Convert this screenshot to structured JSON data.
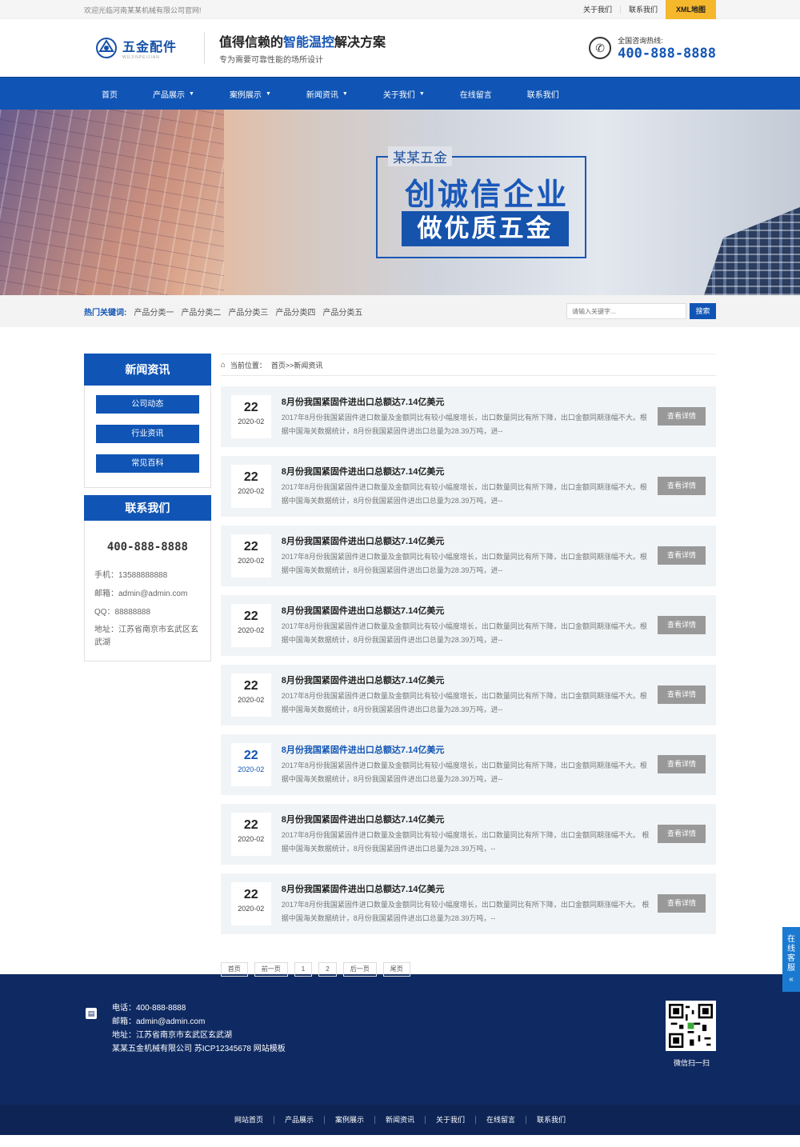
{
  "topbar": {
    "welcome": "欢迎光临河南某某机械有限公司官网!",
    "links": [
      "关于我们",
      "联系我们"
    ],
    "xml": "XML地图"
  },
  "header": {
    "logo_name": "五金配件",
    "logo_sub": "WUJINPEIJIAN",
    "slogan_pre": "值得信赖的",
    "slogan_hl": "智能温控",
    "slogan_post": "解决方案",
    "slogan_sub": "专为需要可靠性能的场所设计",
    "hotline_label": "全国咨询热线:",
    "hotline": "400-888-8888"
  },
  "nav": [
    {
      "label": "首页",
      "dropdown": false
    },
    {
      "label": "产品展示",
      "dropdown": true
    },
    {
      "label": "案例展示",
      "dropdown": true
    },
    {
      "label": "新闻资讯",
      "dropdown": true
    },
    {
      "label": "关于我们",
      "dropdown": true
    },
    {
      "label": "在线留言",
      "dropdown": false
    },
    {
      "label": "联系我们",
      "dropdown": false
    }
  ],
  "banner": {
    "line1": "某某五金",
    "line2": "创诚信企业",
    "line3": "做优质五金"
  },
  "hot": {
    "label": "热门关键词:",
    "keywords": [
      "产品分类一",
      "产品分类二",
      "产品分类三",
      "产品分类四",
      "产品分类五"
    ],
    "placeholder": "请输入关键字...",
    "search": "搜索"
  },
  "side": {
    "news_title": "新闻资讯",
    "links": [
      "公司动态",
      "行业资讯",
      "常见百科"
    ],
    "contact_title": "联系我们",
    "phone": "400-888-8888",
    "mobile": "手机：13588888888",
    "email": "邮箱：admin@admin.com",
    "qq": "QQ：88888888",
    "address": "地址：江苏省南京市玄武区玄武湖"
  },
  "crumb": {
    "label": "当前位置：",
    "path": "首页>>新闻资讯"
  },
  "news": [
    {
      "day": "22",
      "ym": "2020-02",
      "title": "8月份我国紧固件进出口总额达7.14亿美元",
      "desc": "2017年8月份我国紧固件进口数量及金额同比有较小幅度增长，出口数量同比有所下降，出口金额同期涨幅不大。根据中国海关数据统计，8月份我国紧固件进出口总量为28.39万吨，进--",
      "btn": "查看详情"
    },
    {
      "day": "22",
      "ym": "2020-02",
      "title": "8月份我国紧固件进出口总额达7.14亿美元",
      "desc": "2017年8月份我国紧固件进口数量及金额同比有较小幅度增长，出口数量同比有所下降，出口金额同期涨幅不大。根据中国海关数据统计，8月份我国紧固件进出口总量为28.39万吨，进--",
      "btn": "查看详情"
    },
    {
      "day": "22",
      "ym": "2020-02",
      "title": "8月份我国紧固件进出口总额达7.14亿美元",
      "desc": "2017年8月份我国紧固件进口数量及金额同比有较小幅度增长，出口数量同比有所下降，出口金额同期涨幅不大。根据中国海关数据统计，8月份我国紧固件进出口总量为28.39万吨，进--",
      "btn": "查看详情"
    },
    {
      "day": "22",
      "ym": "2020-02",
      "title": "8月份我国紧固件进出口总额达7.14亿美元",
      "desc": "2017年8月份我国紧固件进口数量及金额同比有较小幅度增长，出口数量同比有所下降，出口金额同期涨幅不大。根据中国海关数据统计，8月份我国紧固件进出口总量为28.39万吨，进--",
      "btn": "查看详情"
    },
    {
      "day": "22",
      "ym": "2020-02",
      "title": "8月份我国紧固件进出口总额达7.14亿美元",
      "desc": "2017年8月份我国紧固件进口数量及金额同比有较小幅度增长，出口数量同比有所下降，出口金额同期涨幅不大。根据中国海关数据统计，8月份我国紧固件进出口总量为28.39万吨，进--",
      "btn": "查看详情"
    },
    {
      "day": "22",
      "ym": "2020-02",
      "title": "8月份我国紧固件进出口总额达7.14亿美元",
      "desc": "2017年8月份我国紧固件进口数量及金额同比有较小幅度增长，出口数量同比有所下降，出口金额同期涨幅不大。根据中国海关数据统计，8月份我国紧固件进出口总量为28.39万吨，进--",
      "btn": "查看详情"
    },
    {
      "day": "22",
      "ym": "2020-02",
      "title": "8月份我国紧固件进出口总额达7.14亿美元",
      "desc": "2017年8月份我国紧固件进口数量及金额同比有较小幅度增长，出口数量同比有所下降，出口金额同期涨幅不大。 根据中国海关数据统计，8月份我国紧固件进出口总量为28.39万吨，--",
      "btn": "查看详情"
    },
    {
      "day": "22",
      "ym": "2020-02",
      "title": "8月份我国紧固件进出口总额达7.14亿美元",
      "desc": "2017年8月份我国紧固件进口数量及金额同比有较小幅度增长，出口数量同比有所下降，出口金额同期涨幅不大。 根据中国海关数据统计，8月份我国紧固件进出口总量为28.39万吨，--",
      "btn": "查看详情"
    }
  ],
  "pager": [
    "首页",
    "前一页",
    "1",
    "2",
    "后一页",
    "尾页"
  ],
  "float": "在线客服",
  "footer": {
    "tel": "电话：400-888-8888",
    "email": "邮箱：admin@admin.com",
    "addr": "地址：江苏省南京市玄武区玄武湖",
    "copy": "某某五金机械有限公司 苏ICP12345678 网站模板",
    "qr_caption": "微信扫一扫",
    "nav": [
      "网站首页",
      "产品展示",
      "案例展示",
      "新闻资讯",
      "关于我们",
      "在线留言",
      "联系我们"
    ]
  },
  "colors": {
    "primary": "#1055b5",
    "accent": "#f5b72c",
    "footer": "#0f2a62"
  }
}
